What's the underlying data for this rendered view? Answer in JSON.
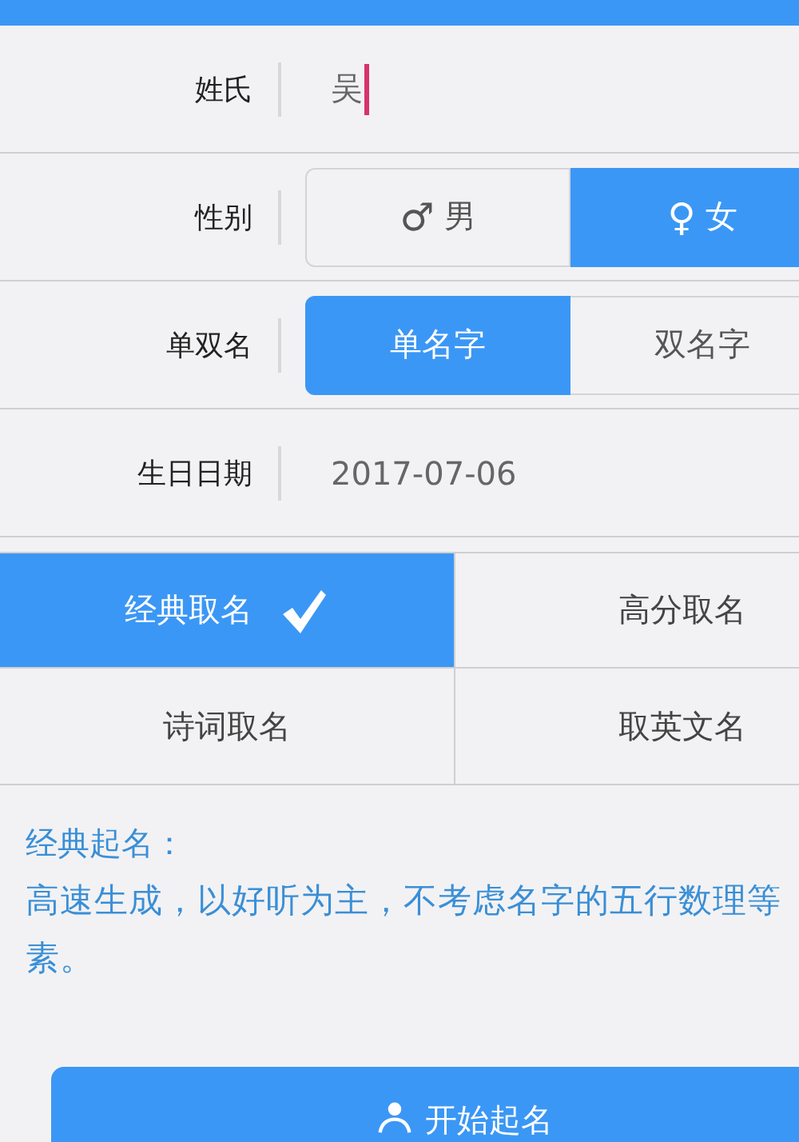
{
  "fields": [
    {
      "kind": "text",
      "label": "姓氏",
      "value": "吴",
      "focused": true
    },
    {
      "kind": "segmented",
      "label": "性别",
      "options": [
        {
          "symbol": "♂",
          "label": "男",
          "selected": false
        },
        {
          "symbol": "♀",
          "label": "女",
          "selected": true
        }
      ]
    },
    {
      "kind": "segmented",
      "label": "单双名",
      "options": [
        {
          "label": "单名字",
          "selected": true
        },
        {
          "label": "双名字",
          "selected": false
        }
      ]
    },
    {
      "kind": "date",
      "label": "生日日期",
      "value": "2017-07-06"
    }
  ],
  "modes": [
    {
      "label": "经典取名",
      "selected": true
    },
    {
      "label": "高分取名",
      "selected": false
    },
    {
      "label": "诗词取名",
      "selected": false
    },
    {
      "label": "取英文名",
      "selected": false
    }
  ],
  "description": {
    "title": "经典起名：",
    "lines": [
      "高速生成，以好听为主，不考虑名字的五行数理等",
      "素。"
    ]
  },
  "start_button": {
    "label": "开始起名"
  }
}
